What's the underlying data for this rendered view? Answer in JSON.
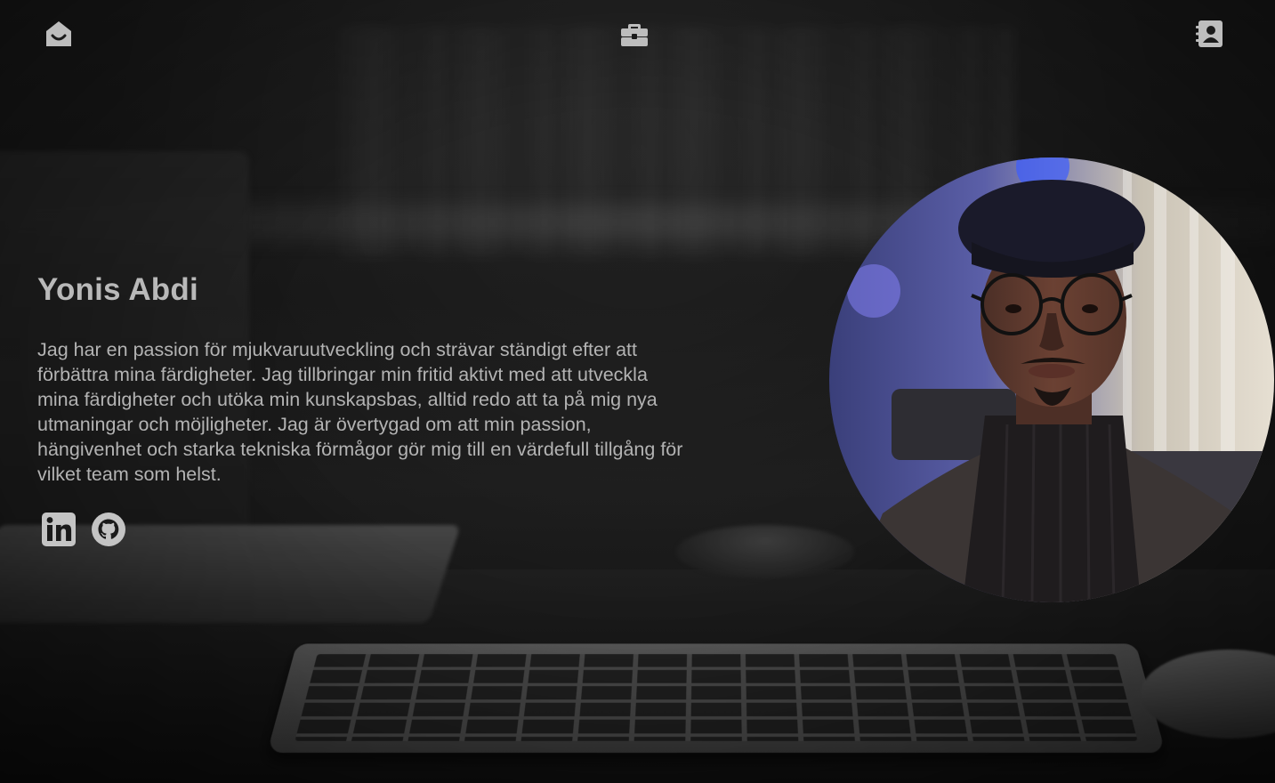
{
  "nav": {
    "home_icon": "home-smile-icon",
    "work_icon": "briefcase-icon",
    "contact_icon": "contact-card-icon"
  },
  "hero": {
    "name": "Yonis Abdi",
    "bio": "Jag har en passion för mjukvaruutveckling och strävar ständigt efter att förbättra mina färdigheter. Jag tillbringar min fritid aktivt med att utveckla mina färdigheter och utöka min kunskapsbas, alltid redo att ta på mig nya utmaningar och möjligheter. Jag är övertygad om att min passion, hängivenhet och starka tekniska förmågor gör mig till en värdefull tillgång för vilket team som helst."
  },
  "social": [
    {
      "icon": "linkedin-icon"
    },
    {
      "icon": "github-icon"
    }
  ],
  "colors": {
    "icon": "#bdbdbd",
    "text": "#b3b3b3",
    "name": "#b9b9b9"
  }
}
